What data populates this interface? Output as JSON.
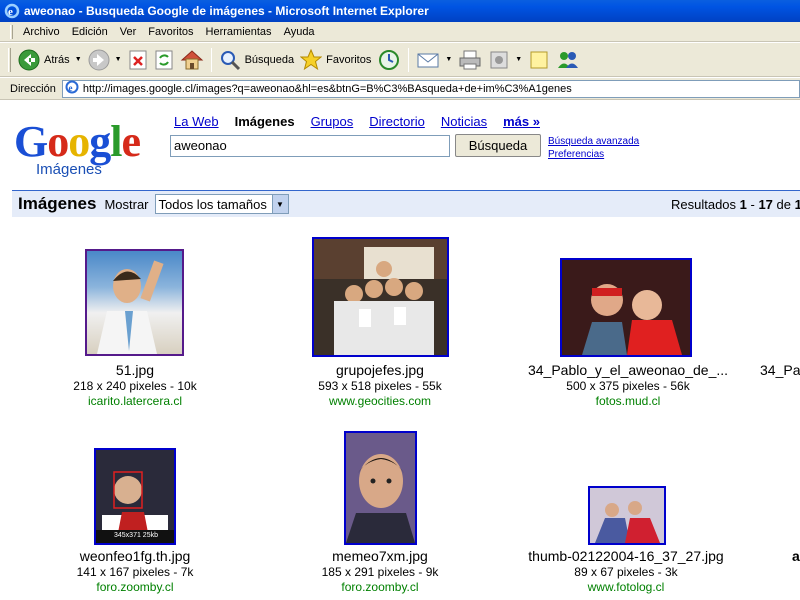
{
  "window": {
    "title": "aweonao - Busqueda Google de imágenes - Microsoft Internet Explorer"
  },
  "menu": {
    "items": [
      "Archivo",
      "Edición",
      "Ver",
      "Favoritos",
      "Herramientas",
      "Ayuda"
    ]
  },
  "toolbar": {
    "back_label": "Atrás",
    "search_label": "Búsqueda",
    "favorites_label": "Favoritos"
  },
  "address": {
    "label": "Dirección",
    "url": "http://images.google.cl/images?q=aweonao&hl=es&btnG=B%C3%BAsqueda+de+im%C3%A1genes"
  },
  "google": {
    "logo_text": "Google",
    "logo_sub": "Imágenes",
    "nav": {
      "web": "La Web",
      "images": "Imágenes",
      "groups": "Grupos",
      "directory": "Directorio",
      "news": "Noticias",
      "more": "más »"
    },
    "query": "aweonao",
    "search_button": "Búsqueda",
    "advanced_search": "Búsqueda avanzada",
    "preferences": "Preferencias"
  },
  "results_bar": {
    "title": "Imágenes",
    "show_label": "Mostrar",
    "size_selected": "Todos los tamaños",
    "results_prefix": "Resultados ",
    "range_start": "1",
    "range_sep": " - ",
    "range_end": "17",
    "of_label": " de ",
    "total_partial": "1"
  },
  "results": [
    {
      "filename": "51.jpg",
      "dims": "218 x 240 pixeles - 10k",
      "site": "icarito.latercera.cl"
    },
    {
      "filename": "grupojefes.jpg",
      "dims": "593 x 518 pixeles - 55k",
      "site": "www.geocities.com"
    },
    {
      "filename": "34_Pablo_y_el_aweonao_de_...",
      "dims": "500 x 375 pixeles - 56k",
      "site": "fotos.mud.cl"
    },
    {
      "filename": "34_Pa",
      "dims": "",
      "site": ""
    },
    {
      "filename": "weonfeo1fg.th.jpg",
      "dims": "141 x 167 pixeles - 7k",
      "site": "foro.zoomby.cl"
    },
    {
      "filename": "memeo7xm.jpg",
      "dims": "185 x 291 pixeles - 9k",
      "site": "foro.zoomby.cl"
    },
    {
      "filename": "thumb-02122004-16_37_27.jpg",
      "dims": "89 x 67 pixeles - 3k",
      "site": "www.fotolog.cl"
    },
    {
      "filename": "a",
      "dims": "",
      "site": ""
    }
  ],
  "thumb5_overlay": "345x371 25kb",
  "colors": {
    "link": "#0000cc",
    "visited": "#551a8b",
    "site_green": "#008000",
    "results_bar_bg": "#e5ecf9",
    "results_bar_border": "#3366cc"
  }
}
